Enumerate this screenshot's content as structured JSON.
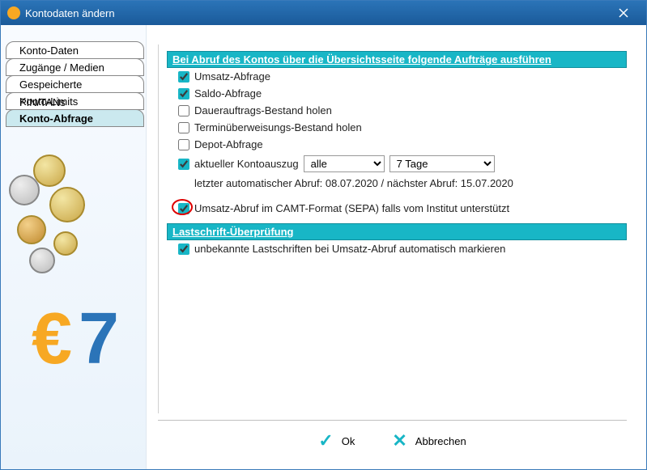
{
  "window": {
    "title": "Kontodaten ändern"
  },
  "tabs": [
    {
      "label": "Konto-Daten"
    },
    {
      "label": "Zugänge / Medien"
    },
    {
      "label": "Gespeicherte PIN/TANs"
    },
    {
      "label": "Konto-Limits"
    },
    {
      "label": "Konto-Abfrage"
    }
  ],
  "section1": {
    "header": "Bei Abruf des Kontos über die Übersichtsseite folgende Aufträge ausführen"
  },
  "checks": {
    "umsatz_abfrage": "Umsatz-Abfrage",
    "saldo_abfrage": "Saldo-Abfrage",
    "dauerauftrag": "Dauerauftrags-Bestand holen",
    "termin": "Terminüberweisungs-Bestand holen",
    "depot": "Depot-Abfrage",
    "kontoauszug": "aktueller Kontoauszug",
    "camt": "Umsatz-Abruf im CAMT-Format (SEPA) falls vom Institut unterstützt"
  },
  "selects": {
    "filter": "alle",
    "period": "7 Tage"
  },
  "info_line": "letzter automatischer Abruf: 08.07.2020 / nächster Abruf: 15.07.2020",
  "section2": {
    "header": "Lastschrift-Überprüfung"
  },
  "checks2": {
    "unbekannte": "unbekannte Lastschriften bei Umsatz-Abruf automatisch markieren"
  },
  "buttons": {
    "ok": "Ok",
    "cancel": "Abbrechen"
  }
}
